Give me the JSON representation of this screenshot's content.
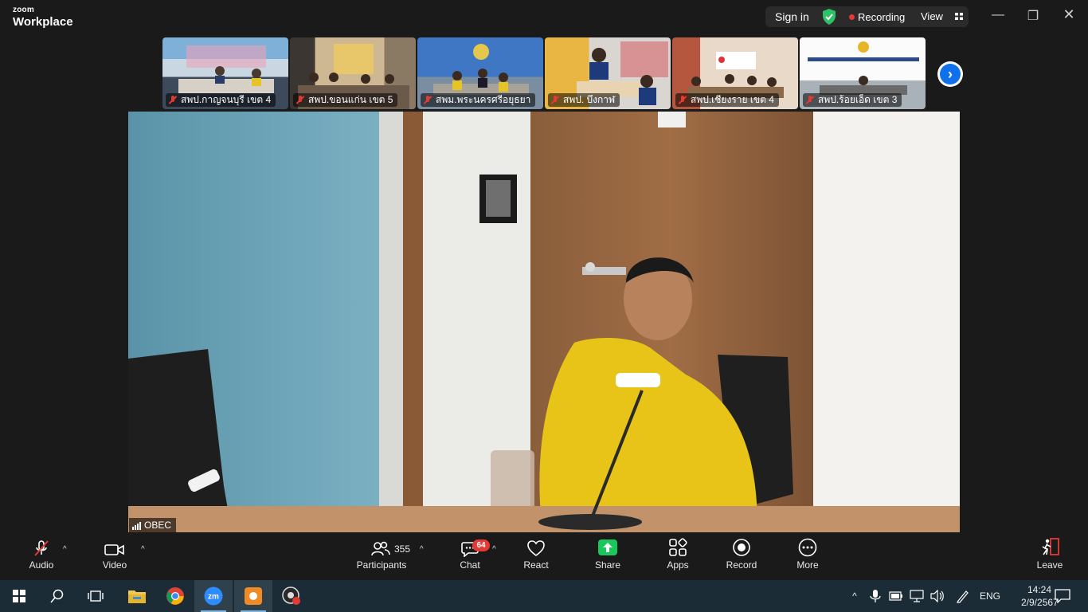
{
  "app": {
    "brand_small": "zoom",
    "brand_large": "Workplace"
  },
  "titlebar": {
    "sign_in": "Sign in",
    "recording": "Recording",
    "view": "View",
    "security_color": "#2ec267",
    "recording_color": "#e53935"
  },
  "thumbnails": [
    {
      "label": "สพป.กาญจนบุรี เขต 4"
    },
    {
      "label": "สพป.ขอนแก่น เขต 5"
    },
    {
      "label": "สพม.พระนครศรีอยุธยา"
    },
    {
      "label": "สพป. บึงกาฬ"
    },
    {
      "label": "สพป.เชียงราย เขต 4"
    },
    {
      "label": "สพป.ร้อยเอ็ด เขต 3"
    }
  ],
  "main_video": {
    "name": "OBEC"
  },
  "toolbar": {
    "audio": "Audio",
    "video": "Video",
    "participants": "Participants",
    "participant_count": "355",
    "chat": "Chat",
    "chat_badge": "64",
    "react": "React",
    "share": "Share",
    "apps": "Apps",
    "record": "Record",
    "more": "More",
    "leave": "Leave",
    "share_color": "#19c85d",
    "leave_color": "#e53935"
  },
  "taskbar": {
    "language": "ENG",
    "time": "14:24",
    "date": "2/9/2567",
    "apps": [
      "windows-start",
      "search",
      "task-view",
      "file-explorer",
      "chrome",
      "zoom",
      "orange-app",
      "recorder"
    ]
  }
}
